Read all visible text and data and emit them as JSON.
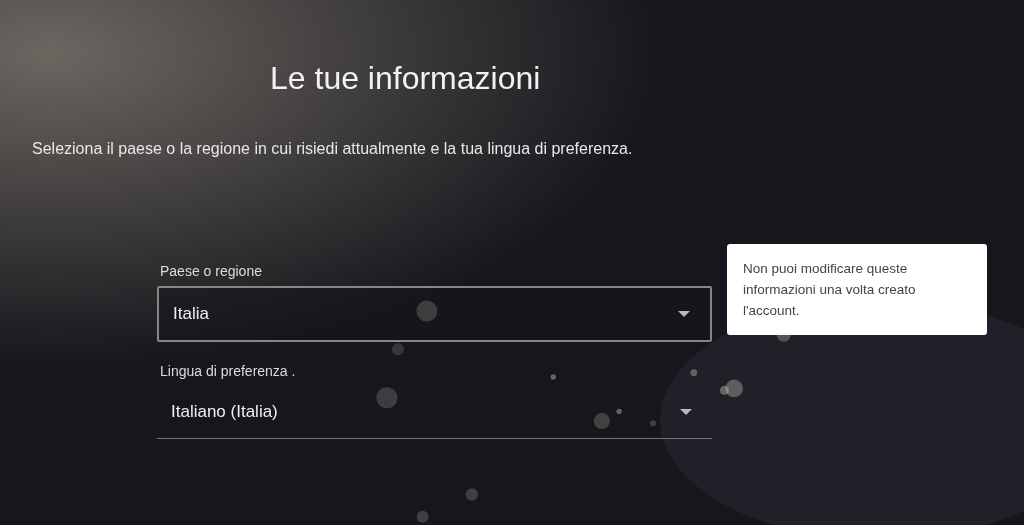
{
  "title": "Le tue informazioni",
  "description": "Seleziona il paese o la regione in cui risiedi attualmente e la tua lingua di preferenza.",
  "fields": [
    {
      "label": "Paese o regione",
      "value": "Italia",
      "selected": true
    },
    {
      "label": "Lingua di preferenza .",
      "value": "Italiano (Italia)",
      "selected": false
    }
  ],
  "tooltip": "Non puoi modificare queste informazioni una volta creato l'account."
}
